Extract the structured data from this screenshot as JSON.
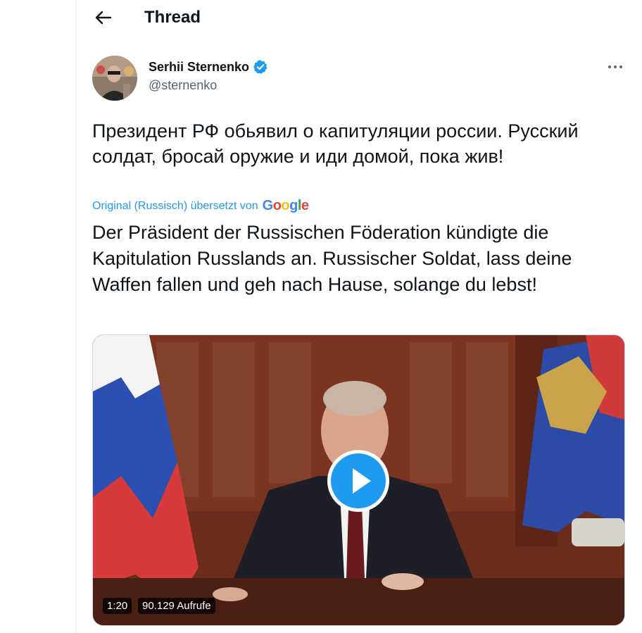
{
  "header": {
    "title": "Thread",
    "back_icon": "arrow-left-icon"
  },
  "tweet": {
    "author_name": "Serhii Sternenko",
    "author_handle": "@sternenko",
    "verified_color": "#1d9bf0",
    "original_text": "Президент РФ обьявил о капитуляции россии. Русский солдат, бросай оружие и иди домой, пока жив!",
    "translation_note": "Original (Russisch) übersetzt von",
    "translator_brand": "Google",
    "translated_text": "Der Präsident der Russischen Föderation kündigte die Kapitulation Russlands an. Russischer Soldat, lass deine Waffen fallen und geh nach Hause, solange du lebst!",
    "video": {
      "duration": "1:20",
      "views": "90.129 Aufrufe"
    }
  },
  "colors": {
    "accent": "#1d9bf0",
    "text": "#0f1419",
    "muted": "#536471"
  }
}
